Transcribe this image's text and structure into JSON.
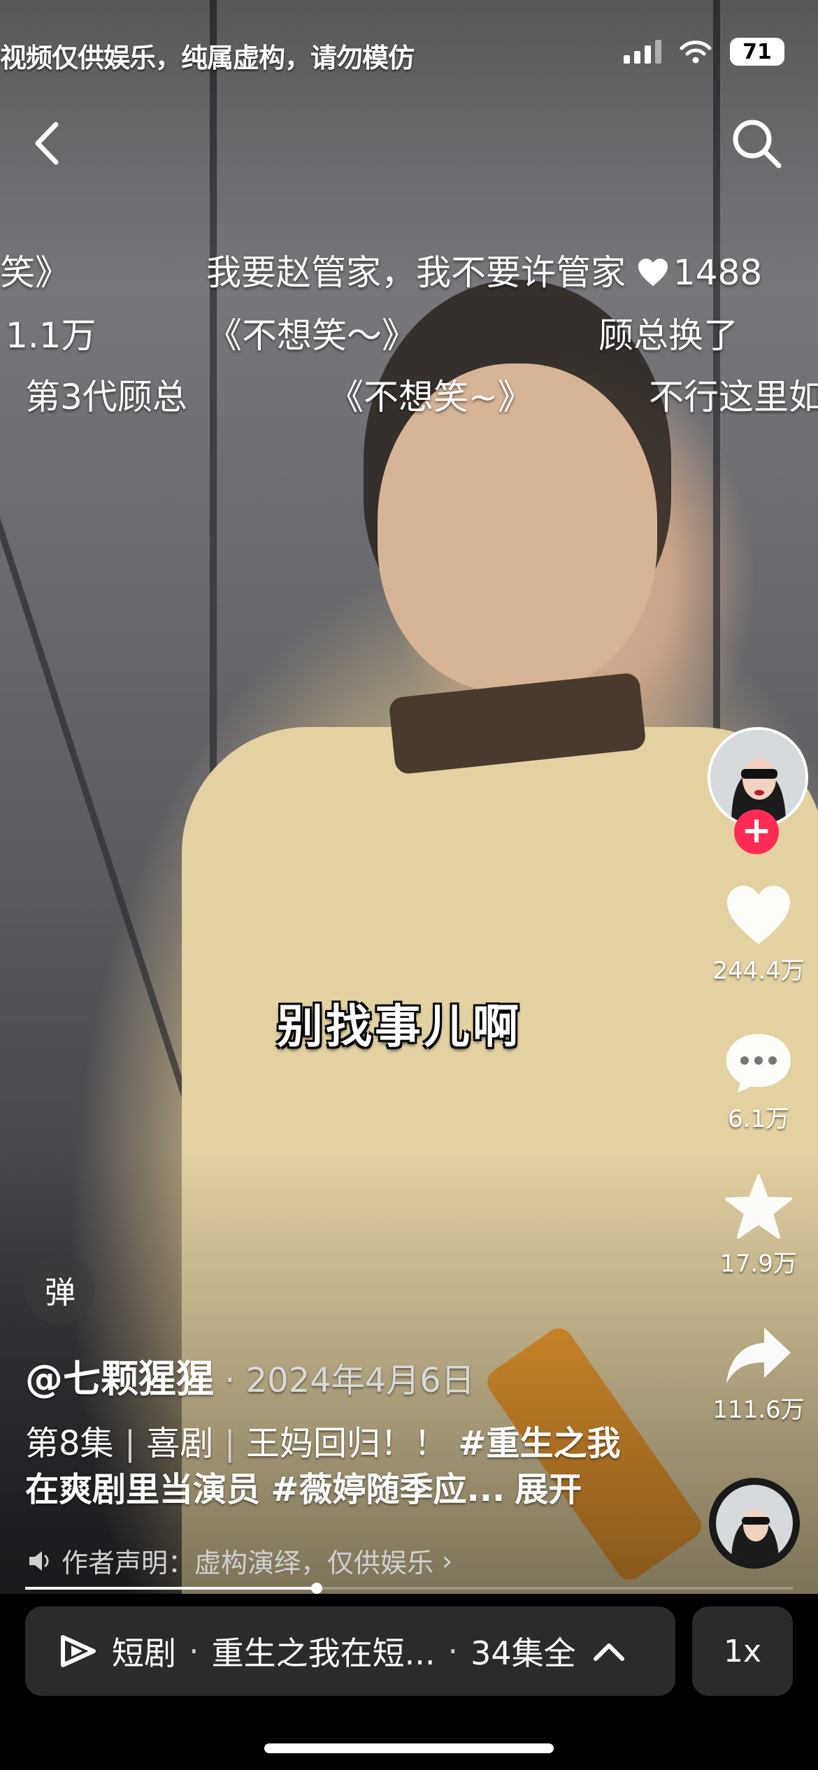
{
  "status_bar": {
    "overlay_text": "视频仅供娱乐，纯属虚构，请勿模仿",
    "battery": "71"
  },
  "danmaku": {
    "row1": [
      "笑》",
      "我要赵管家，我不要许管家"
    ],
    "row1_like_count": "1488",
    "row2": [
      "1.1万",
      "《不想笑～》",
      "顾总换了"
    ],
    "row3": [
      "第3代顾总",
      "《不想笑~》",
      "不行这里如"
    ]
  },
  "caption": "别找事儿啊",
  "actions": {
    "likes": "244.4万",
    "comments": "6.1万",
    "favorites": "17.9万",
    "shares": "111.6万"
  },
  "danmu_toggle": "弹",
  "author": {
    "handle": "@七颗猩猩",
    "date": "· 2024年4月6日"
  },
  "description": {
    "episode": "第8集",
    "genre": "喜剧",
    "title": "王妈回归！！",
    "tag1": "#重生之我在爽剧里当演员",
    "tag2": "#薇婷随季应...",
    "expand": "展开"
  },
  "notice": "作者声明：虚构演绎，仅供娱乐",
  "progress": 0.38,
  "bottom_bar": {
    "label": "短剧",
    "series": "重生之我在短...",
    "episodes": "34集全",
    "speed": "1x"
  },
  "colors": {
    "follow": "#fe2c55",
    "panel": "#2b2b2d"
  },
  "icons": [
    "back-icon",
    "search-icon",
    "heart-icon",
    "comment-icon",
    "star-icon",
    "share-icon",
    "speaker-icon",
    "play-series-icon",
    "chevron-up-icon"
  ]
}
